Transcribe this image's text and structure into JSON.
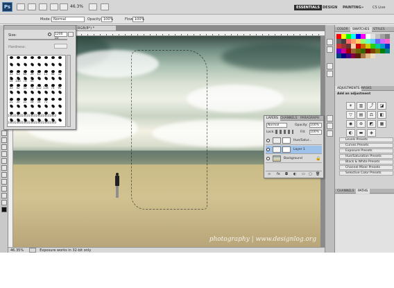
{
  "app": {
    "logo": "Ps",
    "zoom": "46.3%",
    "workspaces": [
      "ESSENTIALS",
      "DESIGN",
      "PAINTING",
      "»",
      "CS Live"
    ],
    "active_workspace": "ESSENTIALS"
  },
  "options": {
    "mode_label": "Mode:",
    "mode_value": "Normal",
    "opacity_label": "Opacity:",
    "opacity_value": "100%",
    "flow_label": "Flow:",
    "flow_value": "100%"
  },
  "document": {
    "tab_title": "RGB/8*) *",
    "zoom_status": "46.35%",
    "status_text": "Exposure works in 32-bit only",
    "watermark": "photography | www.designlog.org"
  },
  "brush_panel": {
    "size_label": "Size:",
    "size_value": "1200 px",
    "hardness_label": "Hardness:",
    "rows": [
      [
        "",
        "",
        "",
        "",
        "",
        "",
        "",
        ""
      ],
      [
        "",
        "",
        "",
        "",
        "",
        "",
        "",
        ""
      ],
      [
        "33",
        "63",
        "66",
        "39",
        "63",
        "11",
        "48",
        "32"
      ],
      [
        "55",
        "100",
        "75",
        "45",
        "",
        "",
        "",
        ""
      ],
      [
        "33",
        "42",
        "55",
        "70",
        "112",
        "134",
        "74",
        "95"
      ],
      [
        "",
        "",
        "",
        "",
        "",
        "",
        "",
        ""
      ],
      [
        "25",
        "30",
        "25",
        "58",
        "58",
        "71",
        "",
        ""
      ],
      [
        "",
        "",
        "",
        "",
        "",
        "",
        "",
        ""
      ],
      [
        "1463",
        "1463",
        "1463",
        "1463",
        "1463",
        "1463",
        "1463",
        ""
      ],
      [
        "1463",
        "1463",
        "1463",
        "1463",
        "1463",
        "1463",
        "1463",
        ""
      ]
    ]
  },
  "right_panels": {
    "color_tabs": [
      "COLOR",
      "SWATCHES",
      "STYLES"
    ],
    "active_color_tab": "SWATCHES",
    "adjust_tabs": [
      "ADJUSTMENTS",
      "MASKS"
    ],
    "active_adjust_tab": "ADJUSTMENTS",
    "adjust_title": "Add an adjustment",
    "presets": [
      "Levels Presets",
      "Curves Presets",
      "Exposure Presets",
      "Hue/Saturation Presets",
      "Black & White Presets",
      "Channel Mixer Presets",
      "Selective Color Presets"
    ],
    "bottom_tabs": [
      "CHANNELS",
      "PATHS"
    ],
    "active_bottom_tab": "PATHS",
    "swatch_colors": [
      "#ff0000",
      "#ffff00",
      "#00ff00",
      "#00ffff",
      "#0000ff",
      "#ff00ff",
      "#ffffff",
      "#e0e0e0",
      "#c0c0c0",
      "#a0a0a0",
      "#808080",
      "#606060",
      "#404040",
      "#ff6666",
      "#ff9966",
      "#ffcc66",
      "#99ff66",
      "#66ffcc",
      "#66ccff",
      "#6666ff",
      "#cc66ff",
      "#ff66cc",
      "#cc3333",
      "#993333",
      "#663333",
      "#ffccaa",
      "#cc0000",
      "#cc6600",
      "#cccc00",
      "#33cc00",
      "#00cc99",
      "#0099cc",
      "#0033cc",
      "#6600cc",
      "#cc0099",
      "#990000",
      "#996633",
      "#666600",
      "#336600",
      "#800000",
      "#804000",
      "#808000",
      "#008000",
      "#008080",
      "#004080",
      "#000080",
      "#400080",
      "#800040",
      "#552200",
      "#aa7744",
      "#ddbb88",
      "#eeddbb"
    ]
  },
  "layers": {
    "tabs": [
      "LAYERS",
      "CHANNELS",
      "PARAGRAPH"
    ],
    "active_tab": "LAYERS",
    "blend_mode": "Normal",
    "opacity_label": "Opacity:",
    "opacity_value": "100%",
    "lock_label": "Lock:",
    "fill_label": "Fill:",
    "fill_value": "100%",
    "rows": [
      {
        "name": "Hue/Satur...",
        "selected": false
      },
      {
        "name": "Layer 1",
        "selected": true
      },
      {
        "name": "Background",
        "selected": false
      }
    ]
  }
}
